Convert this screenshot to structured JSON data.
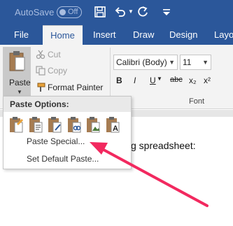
{
  "titlebar": {
    "autosave_label": "AutoSave",
    "autosave_state": "Off",
    "icons": [
      "save-icon",
      "undo-icon",
      "redo-icon",
      "more-icon"
    ]
  },
  "tabs": [
    {
      "label": "File"
    },
    {
      "label": "Home"
    },
    {
      "label": "Insert"
    },
    {
      "label": "Draw"
    },
    {
      "label": "Design"
    },
    {
      "label": "Layo"
    }
  ],
  "ribbon": {
    "paste_label": "Paste",
    "cut_label": "Cut",
    "copy_label": "Copy",
    "format_painter_label": "Format Painter",
    "font_name": "Calibri (Body)",
    "font_size": "11",
    "font_group_label": "Font",
    "format_buttons": [
      "B",
      "I",
      "U",
      "abc",
      "x₂",
      "x²"
    ]
  },
  "paste_menu": {
    "header": "Paste Options:",
    "items": [
      {
        "label": "Paste Special..."
      },
      {
        "label": "Set Default Paste..."
      }
    ]
  },
  "document": {
    "visible_text": "g spreadsheet:"
  },
  "colors": {
    "accent": "#2b579a",
    "arrow": "#f2295f"
  }
}
